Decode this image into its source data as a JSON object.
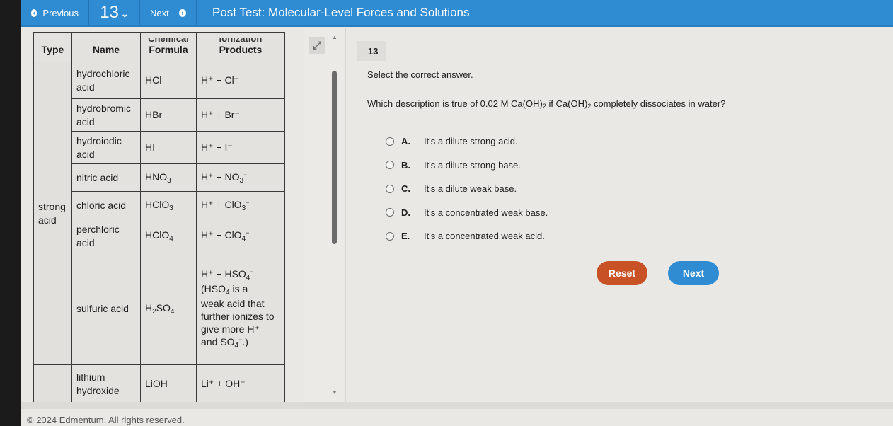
{
  "topbar": {
    "previous_label": "Previous",
    "question_number": "13",
    "next_label": "Next",
    "title": "Post Test: Molecular-Level Forces and Solutions",
    "icons": {
      "previous": "circle-arrow-left-icon",
      "number_dropdown": "chevron-down-icon",
      "next": "circle-arrow-right-icon"
    }
  },
  "reference_table": {
    "headers": {
      "type": "Type",
      "name": "Name",
      "formula_top": "Chemical",
      "formula": "Formula",
      "products_top": "Ionization",
      "products": "Products"
    },
    "type_groups": [
      {
        "label_line1": "strong",
        "label_line2": "acid"
      }
    ],
    "rows": [
      {
        "name": "hydrochloric acid",
        "formula": "HCl",
        "products": "H⁺ + Cl⁻"
      },
      {
        "name": "hydrobromic acid",
        "formula": "HBr",
        "products": "H⁺ + Br⁻"
      },
      {
        "name": "hydroiodic acid",
        "formula": "HI",
        "products": "H⁺ + I⁻"
      },
      {
        "name": "nitric acid",
        "formula_main": "HNO",
        "formula_sub": "3",
        "products_main": "H⁺ + NO",
        "products_sub": "3",
        "products_sup": "−"
      },
      {
        "name": "chloric acid",
        "formula_main": "HClO",
        "formula_sub": "3",
        "products_main": "H⁺ + ClO",
        "products_sub": "3",
        "products_sup": "−"
      },
      {
        "name": "perchloric acid",
        "formula_main": "HClO",
        "formula_sub": "4",
        "products_main": "H⁺ + ClO",
        "products_sub": "4",
        "products_sup": "−"
      },
      {
        "name": "sulfuric acid",
        "formula_a": "H",
        "formula_sub1": "2",
        "formula_b": "SO",
        "formula_sub2": "4",
        "products_line1_main": "H⁺ + HSO",
        "products_line1_sub": "4",
        "products_line1_sup": "−",
        "products_line2_main": "(HSO",
        "products_line2_sub": "4",
        "products_line2_tail": " is a",
        "products_line3": "weak acid that",
        "products_line4": "further ionizes to",
        "products_line5": "give more H⁺",
        "products_line6_main": "and SO",
        "products_line6_sub": "4",
        "products_line6_sup": "−",
        "products_line6_tail": ".)"
      },
      {
        "name_line1": "lithium",
        "name_line2": "hydroxide",
        "formula": "LiOH",
        "products": "Li⁺ + OH⁻"
      }
    ]
  },
  "panel_controls": {
    "expand_icon": "expand-arrows-icon",
    "scroll_up_icon": "triangle-up-icon",
    "scroll_down_icon": "triangle-down-icon"
  },
  "question": {
    "number": "13",
    "instruction": "Select the correct answer.",
    "text_part1": "Which description is true of 0.02 M Ca(OH)",
    "text_sub1": "2",
    "text_part2": " if Ca(OH)",
    "text_sub2": "2",
    "text_part3": " completely dissociates in water?",
    "choices": [
      {
        "letter": "A.",
        "text": "It's a dilute strong acid."
      },
      {
        "letter": "B.",
        "text": "It's a dilute strong base."
      },
      {
        "letter": "C.",
        "text": "It's a dilute weak base."
      },
      {
        "letter": "D.",
        "text": "It's a concentrated weak base."
      },
      {
        "letter": "E.",
        "text": "It's a concentrated weak acid."
      }
    ],
    "reset_label": "Reset",
    "next_label": "Next"
  },
  "colors": {
    "header_blue": "#2f8bd2",
    "reset_orange": "#c85226",
    "next_blue": "#2f8bd2"
  },
  "footer": {
    "copyright": "© 2024 Edmentum. All rights reserved."
  }
}
